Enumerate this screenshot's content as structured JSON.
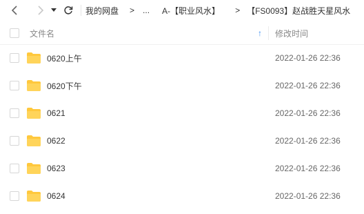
{
  "nav": {
    "back_icon": "chevron-left-icon",
    "forward_icon": "chevron-right-icon",
    "dropdown_icon": "caret-down-icon",
    "refresh_icon": "refresh-icon"
  },
  "breadcrumb": {
    "root": "我的网盘",
    "separator": ">",
    "ellipsis": "...",
    "level1": "A-【职业风水】",
    "level2": "【FS0093】赵战胜天星风水"
  },
  "table": {
    "header_name": "文件名",
    "header_time": "修改时间",
    "sort_icon": "↑",
    "rows": [
      {
        "name": "0620上午",
        "time": "2022-01-26 22:36"
      },
      {
        "name": "0620下午",
        "time": "2022-01-26 22:36"
      },
      {
        "name": "0621",
        "time": "2022-01-26 22:36"
      },
      {
        "name": "0622",
        "time": "2022-01-26 22:36"
      },
      {
        "name": "0623",
        "time": "2022-01-26 22:36"
      },
      {
        "name": "0624",
        "time": "2022-01-26 22:36"
      }
    ]
  },
  "colors": {
    "folder": "#ffc83d",
    "accent": "#3b8ef3"
  }
}
